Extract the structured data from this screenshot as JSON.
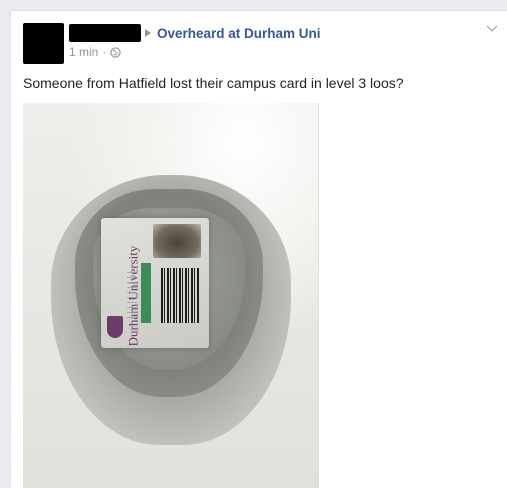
{
  "post": {
    "group_name": "Overheard at Durham Uni",
    "timestamp": "1 min",
    "separator": "·",
    "privacy_icon": "globe-icon",
    "body_text": "Someone from Hatfield lost their campus card in level 3 loos?",
    "menu_icon": "chevron-down-icon"
  },
  "photo": {
    "card_text": "Durham University"
  },
  "colors": {
    "link": "#365899",
    "meta": "#90949c",
    "text": "#1d2129",
    "background": "#e9ebee"
  }
}
